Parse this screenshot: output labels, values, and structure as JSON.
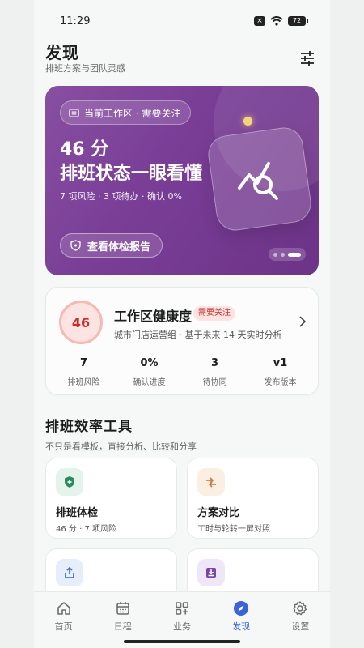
{
  "status": {
    "time": "11:29",
    "battery": "72"
  },
  "header": {
    "title": "发现",
    "subtitle": "排班方案与团队灵感"
  },
  "hero": {
    "tag": "当前工作区 · 需要关注",
    "line1": "46 分",
    "line2": "排班状态一眼看懂",
    "meta": "7 项风险 · 3 项待办 · 确认 0%",
    "cta": "查看体检报告",
    "slides": 3,
    "active_slide": 3
  },
  "health": {
    "score": "46",
    "title": "工作区健康度",
    "badge": "需要关注",
    "subtitle": "城市门店运营组 · 基于未来 14 天实时分析",
    "stats": [
      {
        "value": "7",
        "label": "排班风险"
      },
      {
        "value": "0%",
        "label": "确认进度"
      },
      {
        "value": "3",
        "label": "待协同"
      },
      {
        "value": "v1",
        "label": "发布版本"
      }
    ]
  },
  "section": {
    "title": "排班效率工具",
    "subtitle": "不只是看模板，直接分析、比较和分享"
  },
  "tools": [
    {
      "title": "排班体检",
      "subtitle": "46 分 · 7 项风险",
      "icon": "shield-plus-icon",
      "icon_bg": "#e4f3ec",
      "icon_color": "#2e8a5e"
    },
    {
      "title": "方案对比",
      "subtitle": "工时与轮转一屏对照",
      "icon": "swap-arrows-icon",
      "icon_bg": "#fbeee3",
      "icon_color": "#d0743b"
    },
    {
      "title": "",
      "subtitle": "",
      "icon": "share-upload-icon",
      "icon_bg": "#e6edfb",
      "icon_color": "#3a63d6"
    },
    {
      "title": "",
      "subtitle": "",
      "icon": "inbox-download-icon",
      "icon_bg": "#efe6f8",
      "icon_color": "#7b45a8"
    }
  ],
  "tabs": [
    {
      "label": "首页",
      "icon": "home-icon"
    },
    {
      "label": "日程",
      "icon": "calendar-icon"
    },
    {
      "label": "业务",
      "icon": "grid-plus-icon"
    },
    {
      "label": "发现",
      "icon": "compass-icon",
      "active": true
    },
    {
      "label": "设置",
      "icon": "gear-icon"
    }
  ],
  "colors": {
    "accent": "#3a63d6",
    "hero": "#7a3e97",
    "danger": "#c2302a"
  }
}
